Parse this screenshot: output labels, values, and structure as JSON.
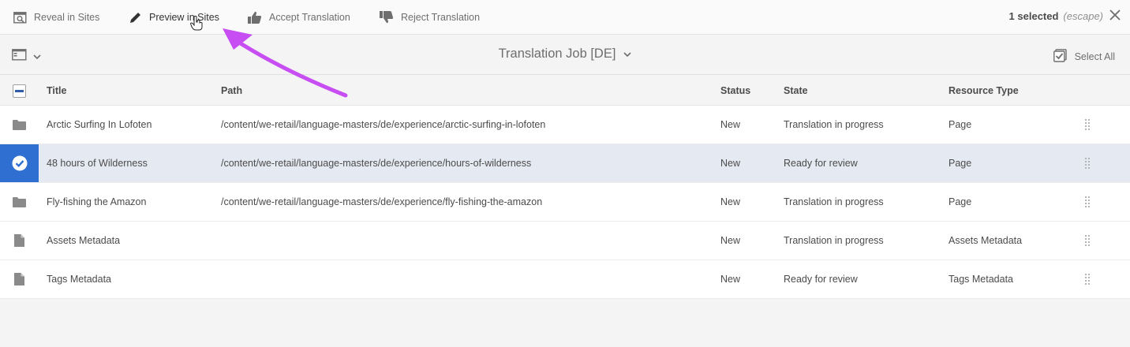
{
  "actionbar": {
    "reveal_label": "Reveal in Sites",
    "preview_label": "Preview in Sites",
    "accept_label": "Accept Translation",
    "reject_label": "Reject Translation",
    "selected_text": "1 selected",
    "escape_text": "(escape)"
  },
  "titlebar": {
    "job_title": "Translation Job [DE]",
    "select_all_label": "Select All"
  },
  "table": {
    "columns": {
      "title": "Title",
      "path": "Path",
      "status": "Status",
      "state": "State",
      "resource_type": "Resource Type"
    },
    "rows": [
      {
        "title": "Arctic Surfing In Lofoten",
        "path": "/content/we-retail/language-masters/de/experience/arctic-surfing-in-lofoten",
        "status": "New",
        "state": "Translation in progress",
        "resource_type": "Page",
        "icon": "folder-icon",
        "selected": false
      },
      {
        "title": "48 hours of Wilderness",
        "path": "/content/we-retail/language-masters/de/experience/hours-of-wilderness",
        "status": "New",
        "state": "Ready for review",
        "resource_type": "Page",
        "icon": "checkmark-circle-icon",
        "selected": true
      },
      {
        "title": "Fly-fishing the Amazon",
        "path": "/content/we-retail/language-masters/de/experience/fly-fishing-the-amazon",
        "status": "New",
        "state": "Translation in progress",
        "resource_type": "Page",
        "icon": "folder-icon",
        "selected": false
      },
      {
        "title": "Assets Metadata",
        "path": "",
        "status": "New",
        "state": "Translation in progress",
        "resource_type": "Assets Metadata",
        "icon": "document-icon",
        "selected": false
      },
      {
        "title": "Tags Metadata",
        "path": "",
        "status": "New",
        "state": "Ready for review",
        "resource_type": "Tags Metadata",
        "icon": "document-icon",
        "selected": false
      }
    ]
  },
  "colors": {
    "selected_row_bg": "#e5e9f2",
    "selected_icon_bg": "#2e6fd1",
    "annotation_arrow": "#c74ef2"
  }
}
